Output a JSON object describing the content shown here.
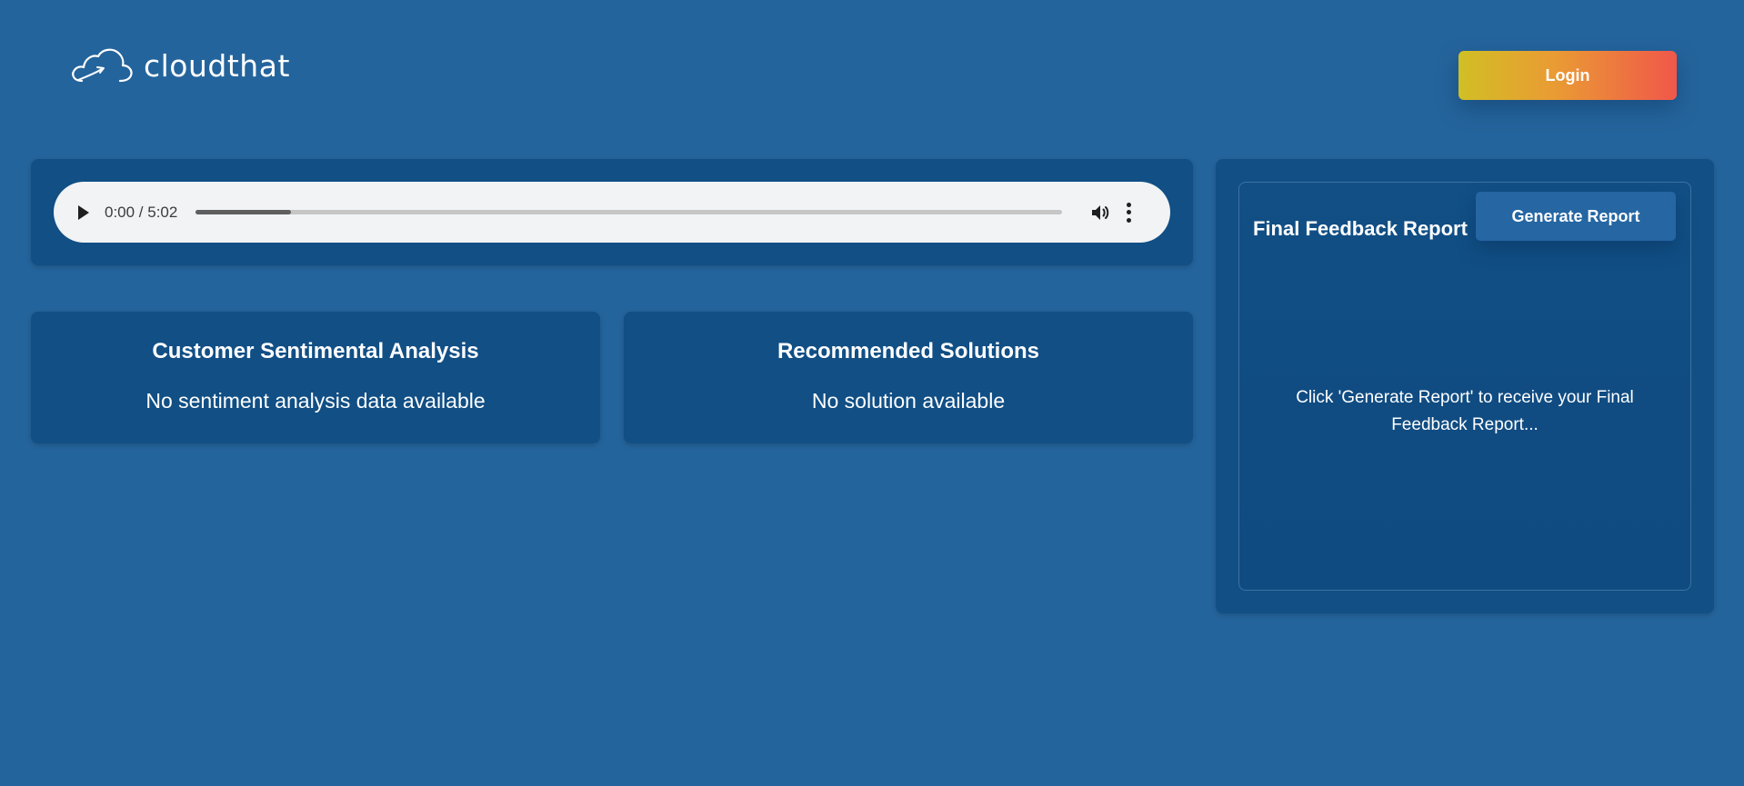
{
  "header": {
    "brand_name": "cloudthat",
    "logo_icon": "cloud-icon",
    "login_label": "Login",
    "login_gradient": [
      "#d1bf25",
      "#f0574a"
    ]
  },
  "audio": {
    "time": "0:00 / 5:02",
    "progress_fraction": 0.11,
    "icons": [
      "play-icon",
      "volume-icon",
      "more-vertical-icon"
    ]
  },
  "cards": {
    "sentiment": {
      "title": "Customer Sentimental Analysis",
      "text": "No sentiment analysis data available"
    },
    "solutions": {
      "title": "Recommended Solutions",
      "text": "No solution available"
    }
  },
  "report": {
    "title": "Final Feedback Report",
    "generate_label": "Generate Report",
    "hint": "Click 'Generate Report' to receive your Final Feedback Report..."
  },
  "colors": {
    "background": "#24649c",
    "panel": "#114f85",
    "generate_button": "#2566a3"
  }
}
